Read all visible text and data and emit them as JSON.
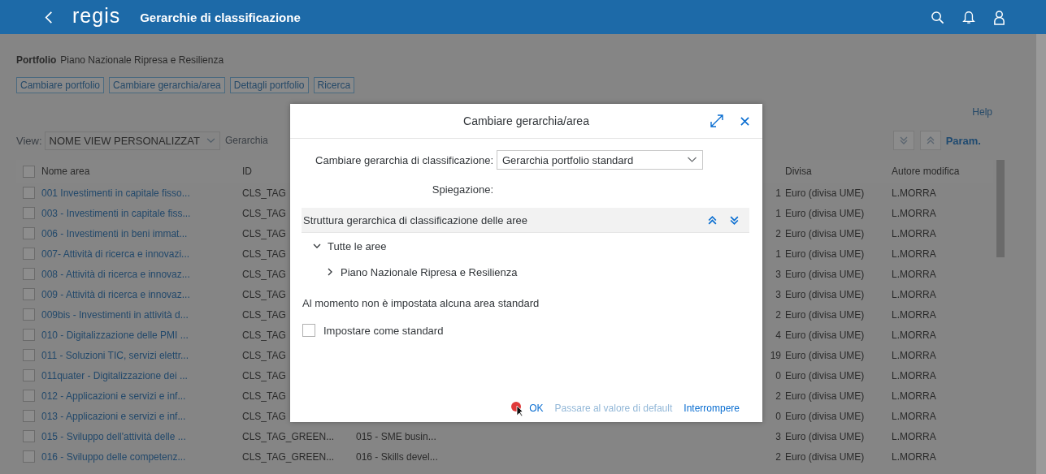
{
  "header": {
    "logo": "regis",
    "title": "Gerarchie di classificazione"
  },
  "portfolio": {
    "label": "Portfolio",
    "value": "Piano Nazionale Ripresa e Resilienza"
  },
  "toolbar_buttons": [
    "Cambiare portfolio",
    "Cambiare gerarchia/area",
    "Dettagli portfolio",
    "Ricerca"
  ],
  "help_link": "Help",
  "view": {
    "label": "View:",
    "value": "NOME VIEW PERSONALIZZAT",
    "next_label": "Gerarchia"
  },
  "param_link": "Param.",
  "table": {
    "select_all_checked": false,
    "columns": [
      "Nome area",
      "ID",
      "Divisa",
      "Autore modifica"
    ],
    "rows": [
      {
        "checked": false,
        "name": "001 Investimenti in capitale fisso...",
        "id": "CLS_TAG",
        "column_4": "1",
        "divisa": "Euro (divisa UME)",
        "autore": "L.MORRA"
      },
      {
        "checked": false,
        "name": "003 - Investimenti in capitale fiss...",
        "id": "CLS_TAG",
        "column_4": "1",
        "divisa": "Euro (divisa UME)",
        "autore": "L.MORRA"
      },
      {
        "checked": false,
        "name": "006 - Investimenti in beni immat...",
        "id": "CLS_TAG",
        "column_4": "2",
        "divisa": "Euro (divisa UME)",
        "autore": "L.MORRA"
      },
      {
        "checked": false,
        "name": "007- Attività di ricerca e innovazi...",
        "id": "CLS_TAG",
        "column_4": "1",
        "divisa": "Euro (divisa UME)",
        "autore": "L.MORRA"
      },
      {
        "checked": false,
        "name": "008 - Attività di ricerca e innovaz...",
        "id": "CLS_TAG",
        "column_4": "3",
        "divisa": "Euro (divisa UME)",
        "autore": "L.MORRA"
      },
      {
        "checked": false,
        "name": "009 - Attività di ricerca e innovaz...",
        "id": "CLS_TAG",
        "column_4": "3",
        "divisa": "Euro (divisa UME)",
        "autore": "L.MORRA"
      },
      {
        "checked": false,
        "name": "009bis - Investimenti in attività d...",
        "id": "CLS_TAG",
        "column_4": "2",
        "divisa": "Euro (divisa UME)",
        "autore": "L.MORRA"
      },
      {
        "checked": false,
        "name": "010 - Digitalizzazione delle PMI ...",
        "id": "CLS_TAG",
        "column_4": "4",
        "divisa": "Euro (divisa UME)",
        "autore": "L.MORRA"
      },
      {
        "checked": false,
        "name": "011 - Soluzioni TIC, servizi elettr...",
        "id": "CLS_TAG",
        "column_4": "19",
        "divisa": "Euro (divisa UME)",
        "autore": "L.MORRA"
      },
      {
        "checked": false,
        "name": "011quater - Digitalizzazione dei ...",
        "id": "CLS_TAG",
        "column_4": "0",
        "divisa": "Euro (divisa UME)",
        "autore": "L.MORRA"
      },
      {
        "checked": false,
        "name": "012 - Applicazioni e servizi e inf...",
        "id": "CLS_TAG",
        "column_4": "2",
        "divisa": "Euro (divisa UME)",
        "autore": "L.MORRA"
      },
      {
        "checked": false,
        "name": "013 - Applicazioni e servizi e inf...",
        "id": "CLS_TAG",
        "column_4": "0",
        "divisa": "Euro (divisa UME)",
        "autore": "L.MORRA"
      },
      {
        "checked": false,
        "name": "015 - Sviluppo dell'attività delle ...",
        "id": "CLS_TAG_GREEN...",
        "column_3": "015 - SME busin...",
        "column_4": "3",
        "divisa": "Euro (divisa UME)",
        "autore": "L.MORRA"
      },
      {
        "checked": false,
        "name": "016 - Sviluppo delle competenz...",
        "id": "CLS_TAG_GREEN...",
        "column_3": "016 - Skills devel...",
        "column_4": "2",
        "divisa": "Euro (divisa UME)",
        "autore": "L.MORRA"
      }
    ]
  },
  "dialog": {
    "title": "Cambiare gerarchia/area",
    "hierarchy_label": "Cambiare gerarchia di classificazione:",
    "hierarchy_value": "Gerarchia portfolio standard",
    "explanation_label": "Spiegazione:",
    "tree": {
      "title": "Struttura gerarchica di classificazione delle aree",
      "nodes": [
        {
          "label": "Tutte le aree",
          "expanded": true,
          "children": [
            {
              "label": "Piano Nazionale Ripresa e Resilienza",
              "expanded": false
            }
          ]
        }
      ]
    },
    "message": "Al momento non è impostata alcuna area standard",
    "set_default": {
      "label": "Impostare come standard",
      "checked": false
    },
    "buttons": [
      {
        "label": "OK",
        "disabled": false
      },
      {
        "label": "Passare al valore di default",
        "disabled": true
      },
      {
        "label": "Interrompere",
        "disabled": false
      }
    ]
  }
}
